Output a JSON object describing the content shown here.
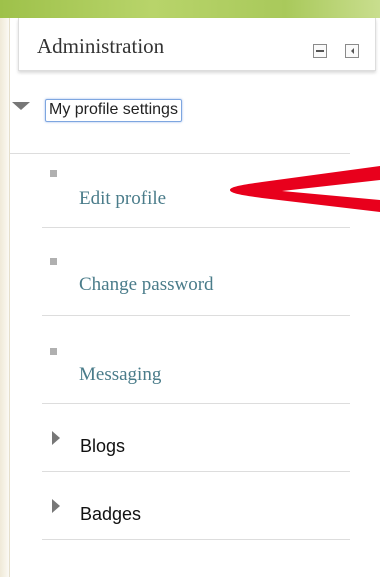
{
  "block": {
    "title": "Administration",
    "controls": {
      "hide_icon": "minus-box-icon",
      "dock_icon": "dock-left-icon"
    }
  },
  "tree": {
    "root": {
      "label": "My profile settings",
      "expanded": true,
      "focused": true
    },
    "items": [
      {
        "label": "Edit profile",
        "type": "leaf"
      },
      {
        "label": "Change password",
        "type": "leaf"
      },
      {
        "label": "Messaging",
        "type": "leaf"
      },
      {
        "label": "Blogs",
        "type": "branch"
      },
      {
        "label": "Badges",
        "type": "branch"
      }
    ]
  },
  "colors": {
    "top_bar": "#a9c95b",
    "link": "#4a7c8a",
    "focus_ring": "#7ea6e0",
    "annotation_arrow": "#e8001c"
  }
}
